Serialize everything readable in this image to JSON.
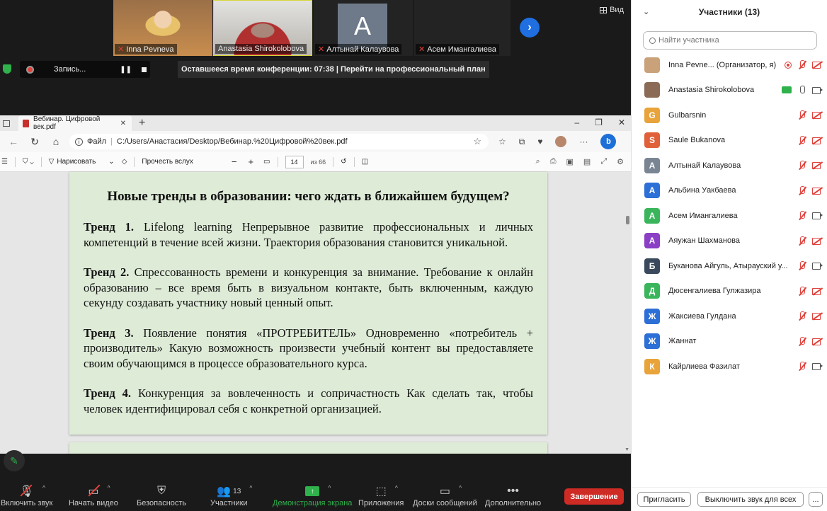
{
  "gallery": {
    "tiles": [
      {
        "name": "Inna Pevneva",
        "mic_off": true,
        "bg": "#c9a27a"
      },
      {
        "name": "Anastasia Shirokolobova",
        "mic_off": false,
        "bg": "#9a8a7c"
      },
      {
        "name": "Алтынай Калаувова",
        "mic_off": true,
        "letter": "A",
        "bg": "#6e7a8a"
      },
      {
        "name": "Асем Имангалиева",
        "mic_off": true,
        "bg": "#232323"
      }
    ],
    "view_label": "Вид"
  },
  "recording": {
    "label": "Запись...",
    "time_banner": "Оставшееся время конференции: 07:38 | Перейти на профессиональный план"
  },
  "browser": {
    "tab_title": "Вебинар. Цифровой век.pdf",
    "url_prefix": "Файл",
    "url": "C:/Users/Анастасия/Desktop/Вебинар.%20Цифровой%20век.pdf",
    "draw_label": "Нарисовать",
    "read_aloud_label": "Прочесть вслух",
    "page_number": "14",
    "page_total": "из 66"
  },
  "document": {
    "heading": "Новые тренды в образовании: чего ждать в ближайшем будущем?",
    "trends": [
      {
        "label": "Тренд 1.",
        "text": " Lifelong learning Непрерывное развитие профессиональных и личных компетенций в течение всей жизни. Траектория образования становится уникальной."
      },
      {
        "label": "Тренд 2.",
        "text": " Спрессованность времени и конкуренция за внимание. Требование к онлайн образованию – все время быть в визуальном контакте, быть включенным, каждую секунду создавать участнику новый ценный опыт."
      },
      {
        "label": "Тренд 3.",
        "text": " Появление понятия «ПРОТРЕБИТЕЛЬ» Одновременно «потребитель + производитель» Какую возможность произвести учебный контент вы предоставляете своим обучающимся в процессе образовательного курса."
      },
      {
        "label": "Тренд 4.",
        "text": " Конкуренция за вовлеченность и сопричастность Как сделать так, чтобы человек идентифицировал себя с конкретной организацией."
      }
    ]
  },
  "toolbar": {
    "mute": "Включить звук",
    "video": "Начать видео",
    "security": "Безопасность",
    "participants": "Участники",
    "participants_count": "13",
    "share": "Демонстрация экрана",
    "apps": "Приложения",
    "whiteboards": "Доски сообщений",
    "more": "Дополнительно",
    "end": "Завершение"
  },
  "panel": {
    "title": "Участники (13)",
    "search_placeholder": "Найти участника",
    "participants": [
      {
        "name": "Inna Pevne... (Организатор, я)",
        "avatar": "photo",
        "color": "#c9a27a",
        "letter": "",
        "recording": true,
        "mic": "off",
        "cam": "off"
      },
      {
        "name": "Anastasia Shirokolobova",
        "avatar": "photo",
        "color": "#8b6b55",
        "letter": "",
        "sharing": true,
        "mic": "on",
        "cam": "on"
      },
      {
        "name": "Gulbarsnin",
        "color": "#e8a33a",
        "letter": "G",
        "mic": "off",
        "cam": "off"
      },
      {
        "name": "Saule Bukanova",
        "color": "#e0603a",
        "letter": "S",
        "mic": "off",
        "cam": "off"
      },
      {
        "name": "Алтынай Калаувова",
        "color": "#7a8593",
        "letter": "А",
        "mic": "off",
        "cam": "off"
      },
      {
        "name": "Альбина Уакбаева",
        "color": "#2c6fd6",
        "letter": "А",
        "mic": "off",
        "cam": "off"
      },
      {
        "name": "Асем Имангалиева",
        "color": "#3bb55c",
        "letter": "А",
        "mic": "off",
        "cam": "on"
      },
      {
        "name": "Аяужан Шахманова",
        "color": "#8a3fc4",
        "letter": "А",
        "mic": "off",
        "cam": "off"
      },
      {
        "name": "Буканова Айгуль, Атырауский у...",
        "color": "#3a4a5c",
        "letter": "Б",
        "mic": "off",
        "cam": "on"
      },
      {
        "name": "Дюсенгалиева Гулжазира",
        "color": "#3bb55c",
        "letter": "Д",
        "mic": "off",
        "cam": "off"
      },
      {
        "name": "Жаксиева Гулдана",
        "color": "#2c6fd6",
        "letter": "Ж",
        "mic": "off",
        "cam": "off"
      },
      {
        "name": "Жаннат",
        "color": "#2c6fd6",
        "letter": "Ж",
        "mic": "off",
        "cam": "off"
      },
      {
        "name": "Кайрлиева Фазилат",
        "color": "#e8a33a",
        "letter": "К",
        "mic": "off",
        "cam": "on"
      }
    ],
    "invite_label": "Пригласить",
    "mute_all_label": "Выключить звук для всех",
    "more_label": "..."
  }
}
